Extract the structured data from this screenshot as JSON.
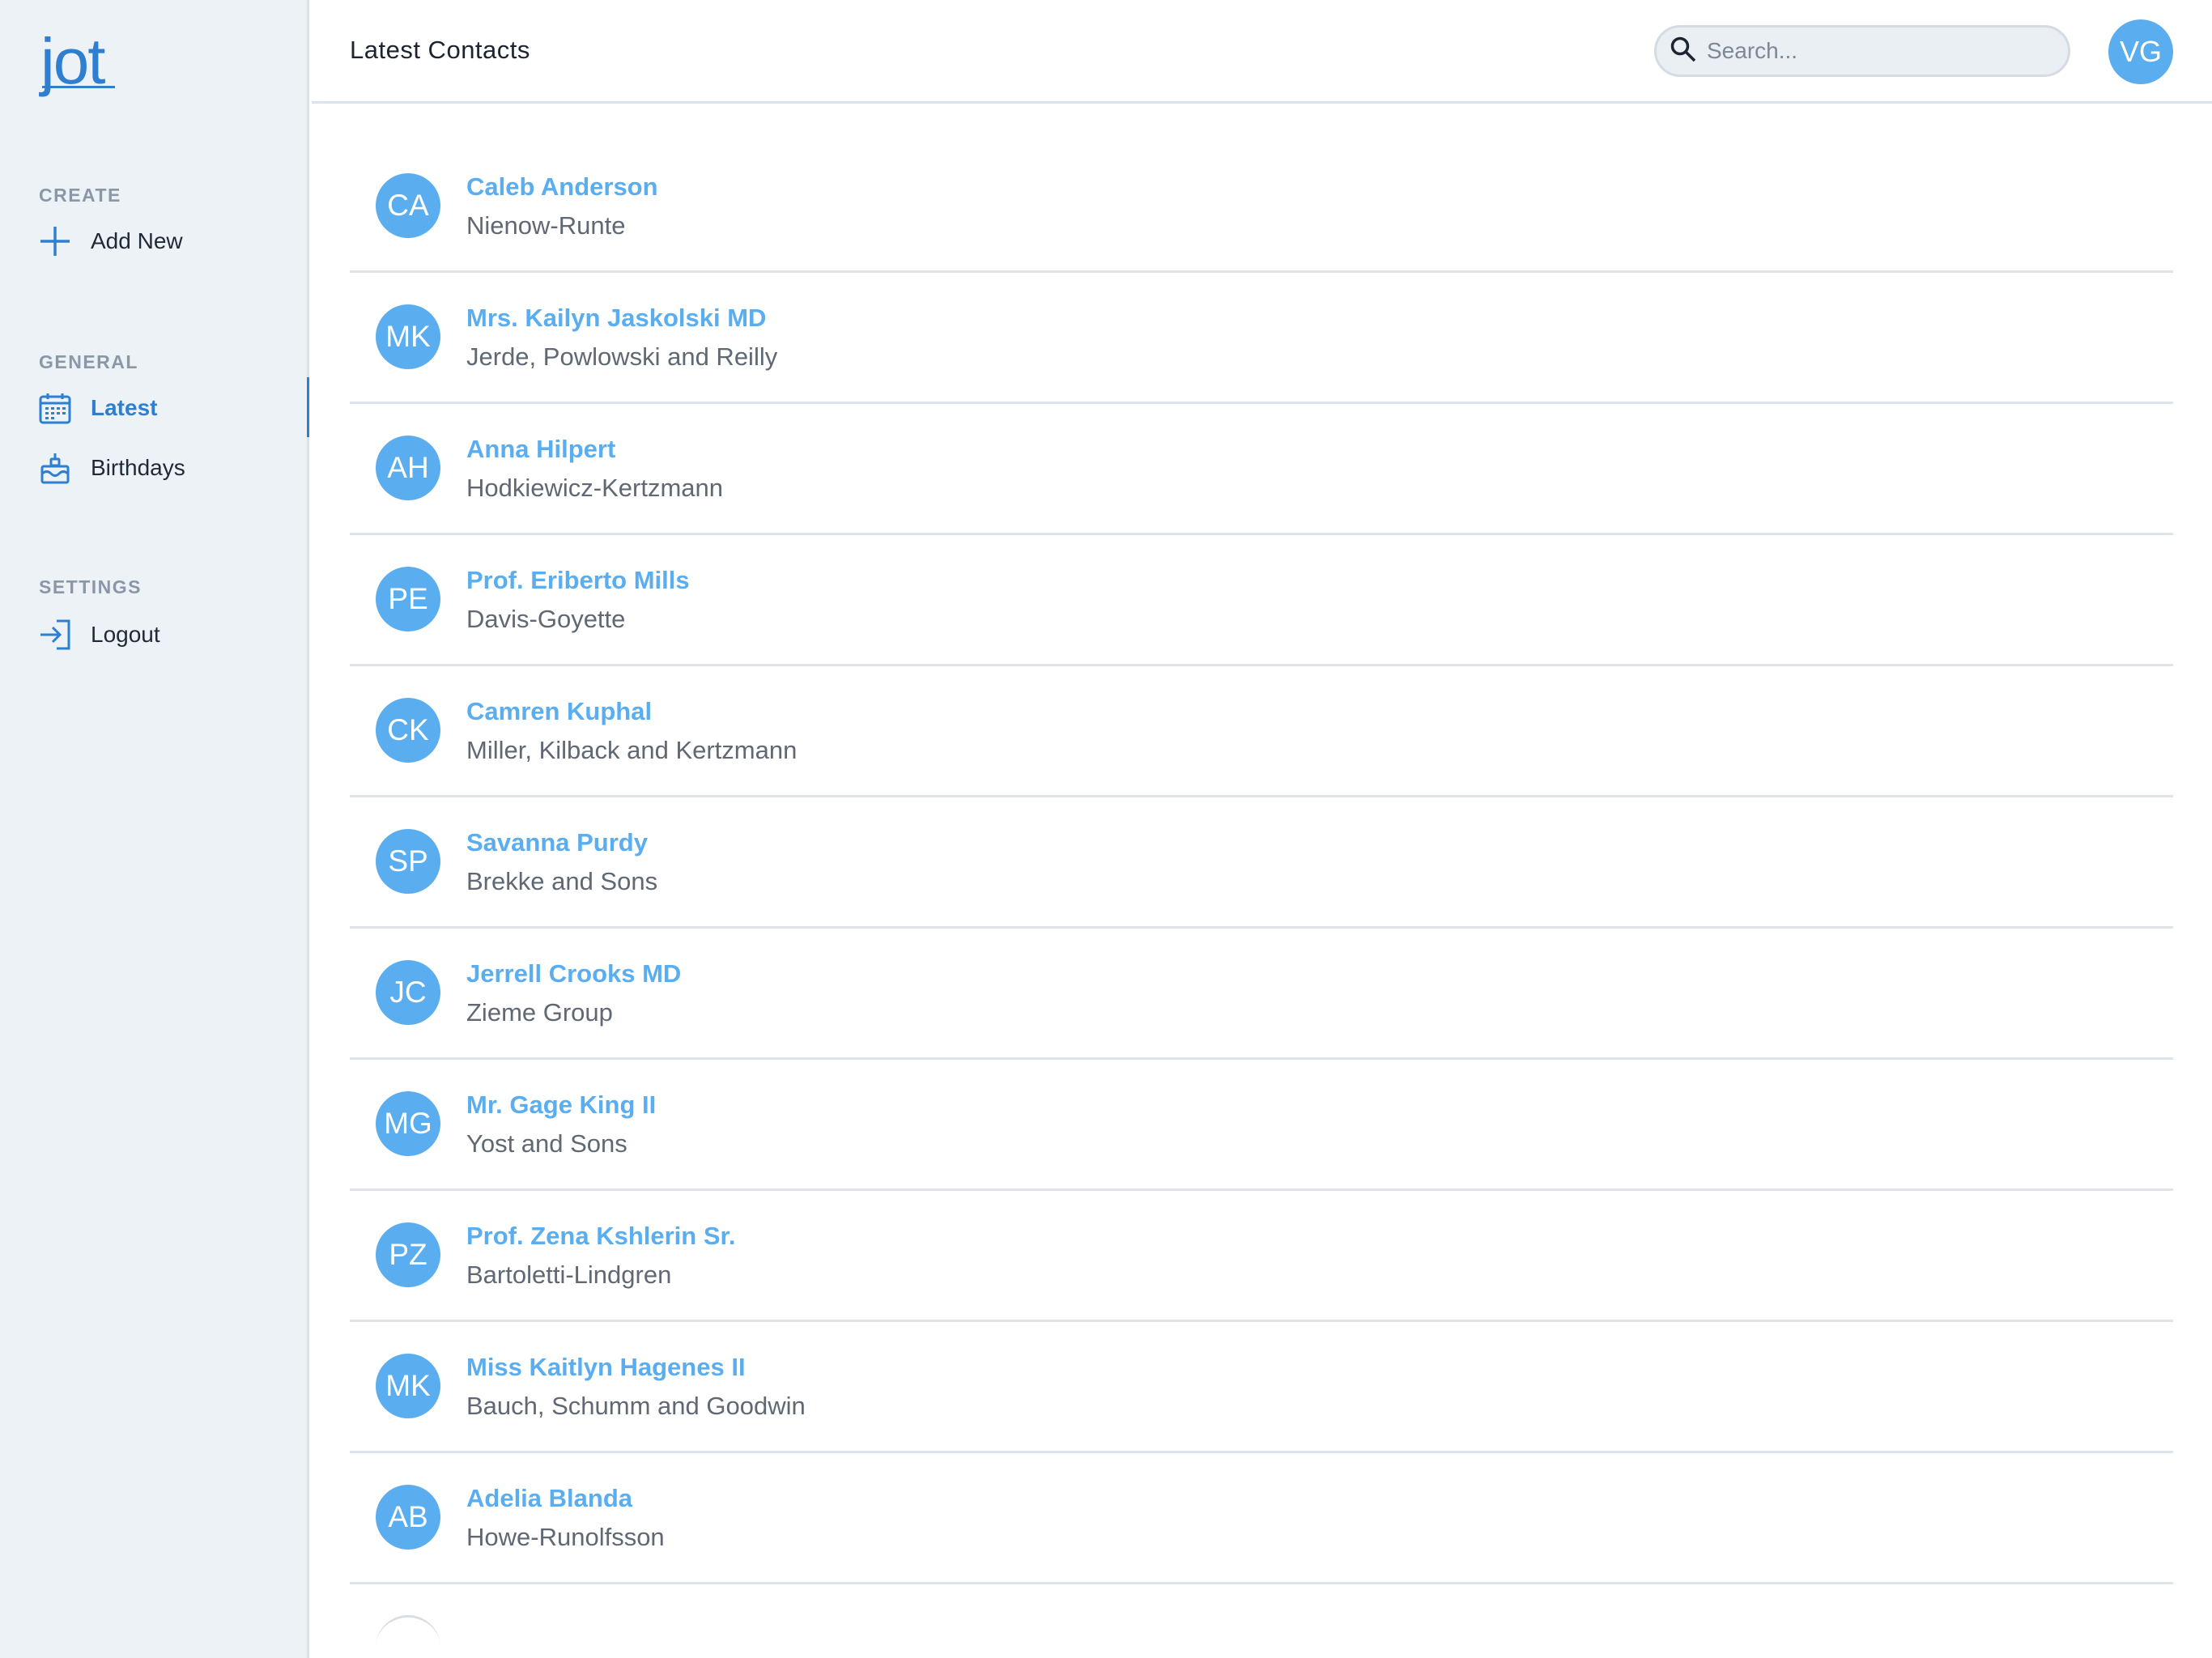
{
  "app": {
    "logo": "jot",
    "accent_color": "#2f7fd0",
    "avatar_color": "#5aaef0"
  },
  "sidebar": {
    "sections": [
      {
        "title": "CREATE",
        "items": [
          {
            "label": "Add New",
            "icon": "plus-icon"
          }
        ]
      },
      {
        "title": "GENERAL",
        "items": [
          {
            "label": "Latest",
            "icon": "calendar-icon",
            "active": true
          },
          {
            "label": "Birthdays",
            "icon": "cake-icon"
          }
        ]
      },
      {
        "title": "SETTINGS",
        "items": [
          {
            "label": "Logout",
            "icon": "logout-icon"
          }
        ]
      }
    ]
  },
  "header": {
    "title": "Latest Contacts",
    "search_placeholder": "Search...",
    "user_initials": "VG"
  },
  "contacts": [
    {
      "initials": "CA",
      "name": "Caleb Anderson",
      "company": "Nienow-Runte"
    },
    {
      "initials": "MK",
      "name": "Mrs. Kailyn Jaskolski MD",
      "company": "Jerde, Powlowski and Reilly"
    },
    {
      "initials": "AH",
      "name": "Anna Hilpert",
      "company": "Hodkiewicz-Kertzmann"
    },
    {
      "initials": "PE",
      "name": "Prof. Eriberto Mills",
      "company": "Davis-Goyette"
    },
    {
      "initials": "CK",
      "name": "Camren Kuphal",
      "company": "Miller, Kilback and Kertzmann"
    },
    {
      "initials": "SP",
      "name": "Savanna Purdy",
      "company": "Brekke and Sons"
    },
    {
      "initials": "JC",
      "name": "Jerrell Crooks MD",
      "company": "Zieme Group"
    },
    {
      "initials": "MG",
      "name": "Mr. Gage King II",
      "company": "Yost and Sons"
    },
    {
      "initials": "PZ",
      "name": "Prof. Zena Kshlerin Sr.",
      "company": "Bartoletti-Lindgren"
    },
    {
      "initials": "MK",
      "name": "Miss Kaitlyn Hagenes II",
      "company": "Bauch, Schumm and Goodwin"
    },
    {
      "initials": "AB",
      "name": "Adelia Blanda",
      "company": "Howe-Runolfsson"
    }
  ]
}
